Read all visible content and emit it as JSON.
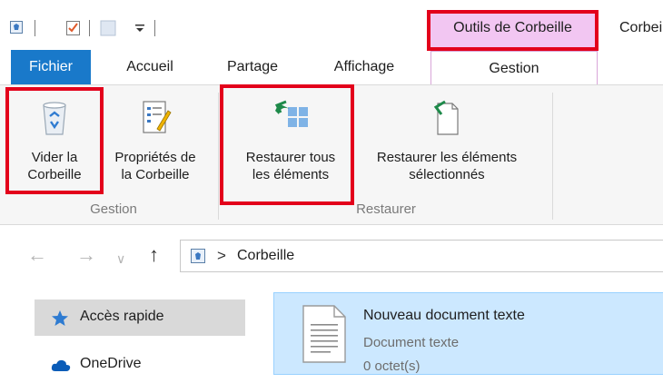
{
  "window": {
    "title": "Corbeille",
    "context_tab_header": "Outils de Corbeille"
  },
  "tabs": [
    {
      "label": "Fichier",
      "active": false
    },
    {
      "label": "Accueil",
      "active": false
    },
    {
      "label": "Partage",
      "active": false
    },
    {
      "label": "Affichage",
      "active": false
    },
    {
      "label": "Gestion",
      "active": true
    }
  ],
  "ribbon": {
    "groups": [
      {
        "label": "Gestion",
        "buttons": [
          {
            "line1": "Vider la",
            "line2": "Corbeille",
            "icon": "recycle-bin-icon"
          },
          {
            "line1": "Propriétés de",
            "line2": "la Corbeille",
            "icon": "properties-icon"
          }
        ]
      },
      {
        "label": "Restaurer",
        "buttons": [
          {
            "line1": "Restaurer tous",
            "line2": "les éléments",
            "icon": "restore-all-icon"
          },
          {
            "line1": "Restaurer les éléments",
            "line2": "sélectionnés",
            "icon": "restore-selected-icon"
          }
        ]
      }
    ]
  },
  "address_bar": {
    "separator": ">",
    "location": "Corbeille"
  },
  "nav_pane": {
    "items": [
      {
        "label": "Accès rapide",
        "icon": "star-icon",
        "selected": true
      },
      {
        "label": "OneDrive",
        "icon": "cloud-icon",
        "selected": false
      }
    ]
  },
  "files": [
    {
      "name": "Nouveau document texte",
      "type": "Document texte",
      "size": "0 octet(s)",
      "selected": true
    }
  ],
  "colors": {
    "accent": "#1979ca",
    "context_tab": "#f2c6f2",
    "highlight_box": "#e3001b",
    "selection": "#cce8ff"
  }
}
